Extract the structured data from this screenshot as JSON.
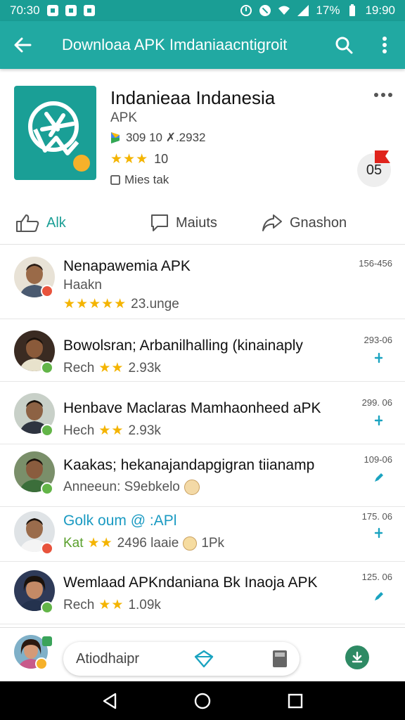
{
  "status_bar": {
    "time_left": "70:30",
    "battery": "17%",
    "clock": "19:90"
  },
  "app_bar": {
    "title": "Downloaa APK Imdaniaacntigroit"
  },
  "app": {
    "name": "Indanieaa Indanesia",
    "type": "APK",
    "meta": "309 10 ✗.2932",
    "rating": "10",
    "size": "Mies tak",
    "badge_number": "05"
  },
  "tabs": [
    {
      "label": "Alk",
      "icon": "thumbs-up-icon"
    },
    {
      "label": "Maiuts",
      "icon": "comment-icon"
    },
    {
      "label": "Gnashon",
      "icon": "share-icon"
    }
  ],
  "rows": [
    {
      "title": "Nenapawemia APK",
      "sub_label": "Haakn",
      "sub_extra": "23.unge",
      "time": "156-456",
      "stars": "★★★★★",
      "badge_color": "#e8533c"
    },
    {
      "title": "Bowolsran; Arbanilhalling (kinainaply",
      "sub_label": "Rech",
      "sub_extra": "2.93k",
      "time": "293-06",
      "stars": "★★",
      "badge_color": "#63b548"
    },
    {
      "title": "Henbave Maclaras Mamhaonheed aPK",
      "sub_label": "Hech",
      "sub_extra": "2.93k",
      "time": "299. 06",
      "stars": "★★",
      "badge_color": "#63b548"
    },
    {
      "title": "Kaakas; hekanajandapgigran tiianamp",
      "sub_label": "Anneeun: S9ebkelo",
      "sub_extra": "",
      "time": "109-06",
      "stars": "",
      "badge_color": "#63b548"
    },
    {
      "title": "Golk oum @ :APl",
      "sub_label": "Kat",
      "sub_extra": "2496  laaie",
      "sub_tail": "1Pk",
      "time": "175. 06",
      "stars": "★★",
      "badge_color": "#e8533c"
    },
    {
      "title": "Wemlaad APKndaniana Bk Inaoja APK",
      "sub_label": "Rech",
      "sub_extra": "1.09k",
      "time": "125. 06",
      "stars": "★★",
      "badge_color": "#63b548"
    }
  ],
  "bottom": {
    "search_placeholder": "Atiodhaipr"
  },
  "colors": {
    "teal": "#21a9a2",
    "star": "#f4b400",
    "accent_action": "#1aa3c0",
    "fab_green": "#2e8a64"
  }
}
